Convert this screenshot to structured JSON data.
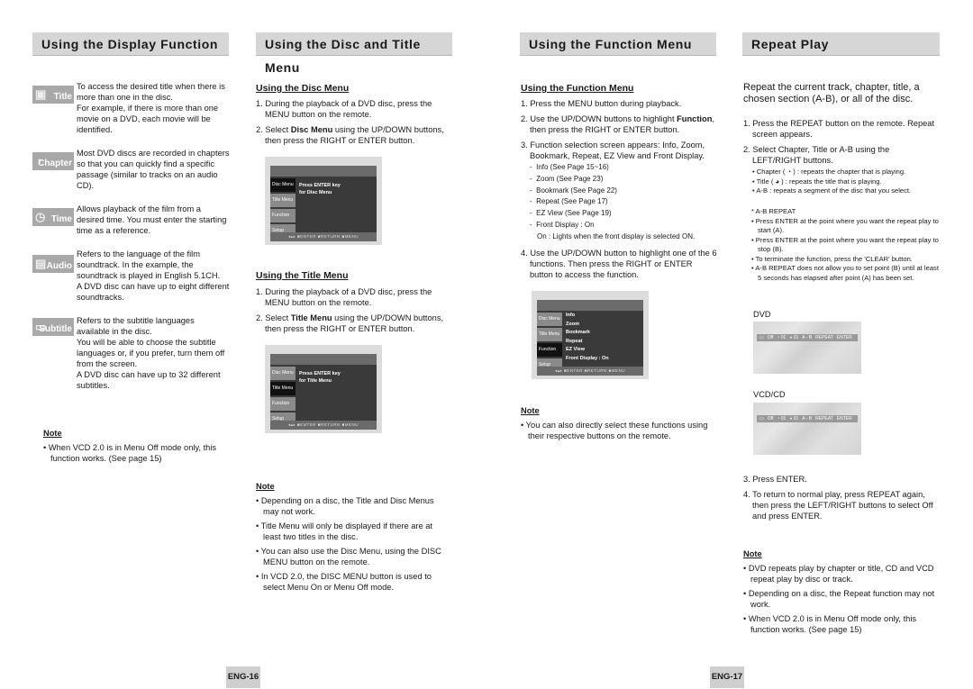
{
  "left_page": {
    "display_section": {
      "header": "Using the Display Function",
      "items": [
        {
          "icon": "title-icon",
          "label": "Title",
          "text": [
            "To access the desired title when there is more than one in the disc.",
            "For example, if there is more than one movie on a DVD, each movie will be identified."
          ]
        },
        {
          "icon": "chapter-icon",
          "label": "Chapter",
          "text": [
            "Most DVD discs are recorded in chapters so that you can quickly find a specific passage (similar to tracks on an audio CD)."
          ]
        },
        {
          "icon": "time-icon",
          "label": "Time",
          "text": [
            "Allows playback of the film from a desired time. You must enter the starting time as a reference."
          ]
        },
        {
          "icon": "audio-icon",
          "label": "Audio",
          "text": [
            "Refers to the language of the film soundtrack. In the example, the soundtrack is played in English 5.1CH.",
            "A DVD disc can have up to eight different soundtracks."
          ]
        },
        {
          "icon": "subtitle-icon",
          "label": "Subtitle",
          "text": [
            "Refers to the subtitle languages available in the disc.",
            "You will be able to choose the subtitle languages or, if you prefer, turn them off from the screen.",
            "A DVD disc can have up to 32 different subtitles."
          ]
        }
      ],
      "note_heading": "Note",
      "notes": [
        "When VCD 2.0 is in Menu Off mode only, this function works. (See page 15)"
      ]
    },
    "disc_title_section": {
      "header": "Using the Disc and Title Menu",
      "disc_menu": {
        "heading": "Using the Disc Menu",
        "steps": [
          {
            "num": "1.",
            "text": "During the playback of a DVD disc, press the MENU button on the remote."
          },
          {
            "num": "2.",
            "pre": "Select ",
            "bold": "Disc Menu",
            "post": " using the UP/DOWN buttons, then press the RIGHT or ENTER button."
          }
        ],
        "screen": {
          "side": [
            "Disc Menu",
            "Title Menu",
            "Function",
            "Setup"
          ],
          "selected": 0,
          "message": [
            "Press ENTER key",
            "for Disc Menu"
          ],
          "bottom": "◂▴▸  ■ENTER  ■RETURN  ■MENU"
        }
      },
      "title_menu": {
        "heading": "Using the Title Menu",
        "steps": [
          {
            "num": "1.",
            "text": "During the playback of a DVD disc, press the MENU button on the remote."
          },
          {
            "num": "2.",
            "pre": "Select ",
            "bold": "Title Menu",
            "post": " using the UP/DOWN buttons, then press the RIGHT or ENTER button."
          }
        ],
        "screen": {
          "side": [
            "Disc Menu",
            "Title Menu",
            "Function",
            "Setup"
          ],
          "selected": 1,
          "message": [
            "Press ENTER key",
            "for Title Menu"
          ],
          "bottom": "◂▴▸  ■ENTER  ■RETURN  ■MENU"
        }
      },
      "note_heading": "Note",
      "notes": [
        "Depending on a disc, the Title and Disc Menus may not work.",
        "Title Menu will only be displayed if there are at least two titles in the disc.",
        "You can also use the Disc Menu, using the DISC MENU button on the remote.",
        "In VCD 2.0, the DISC MENU button is used to select Menu On or Menu Off mode."
      ]
    },
    "page_number": "ENG-16"
  },
  "right_page": {
    "function_section": {
      "header": "Using the Function Menu",
      "heading": "Using the Function Menu",
      "step1": "Press the MENU button during playback.",
      "step2_pre": "Use the UP/DOWN buttons to highlight ",
      "step2_bold": "Function",
      "step2_post": ", then press the RIGHT or ENTER button.",
      "step3": "Function selection screen appears: Info, Zoom, Bookmark, Repeat, EZ View and Front Display.",
      "sub_items": [
        "Info (See Page 15~16)",
        "Zoom (See Page 23)",
        "Bookmark (See Page 22)",
        "Repeat (See Page 17)",
        "EZ View (See Page 19)",
        "Front Display : On"
      ],
      "sub_note": "On : Lights when the front display is selected ON.",
      "step4": "Use the UP/DOWN button to highlight one of the 6 functions. Then press the RIGHT or ENTER button to access the function.",
      "screen": {
        "side": [
          "Disc Menu",
          "Title Menu",
          "Function",
          "Setup"
        ],
        "selected": 2,
        "items": [
          "Info",
          "Zoom",
          "Bookmark",
          "Repeat",
          "EZ View",
          "Front Display : On"
        ],
        "bottom": "◂▴▸  ■ENTER  ■RETURN  ■MENU"
      },
      "note_heading": "Note",
      "notes": [
        "You can also directly select these functions using their respective buttons on the remote."
      ]
    },
    "repeat_section": {
      "header": "Repeat Play",
      "intro": "Repeat the current track, chapter, title, a chosen section (A-B), or all of the disc.",
      "step1": "Press the REPEAT button on the remote. Repeat screen appears.",
      "step2": "Select Chapter, Title or A-B using the LEFT/RIGHT buttons.",
      "step2_bullets": [
        "Chapter ( ◔ ) : repeats the chapter that is playing.",
        "Title ( ◕ ) : repeats the title that is playing.",
        "A-B : repeats a segment of the disc that you select."
      ],
      "ab_heading": "* A-B REPEAT",
      "ab_bullets": [
        "Press ENTER at the point where you want the repeat play to start (A).",
        "Press ENTER at the point where you want the repeat play to stop (B).",
        "To terminate the function, press the 'CLEAR' button.",
        "A-B REPEAT does not allow you to set point (B) until at least 5 seconds has elapsed after point (A) has been set."
      ],
      "dvd_label": "DVD",
      "dvd_bar": [
        "▭",
        "Off",
        "◔ 01",
        "◕ 01",
        "A - B",
        "REPEAT",
        "ENTER"
      ],
      "vcd_label": "VCD/CD",
      "vcd_bar": [
        "▭",
        "Off",
        "◔ 01",
        "◕ 01",
        "A - B",
        "REPEAT",
        "ENTER"
      ],
      "step3": "Press ENTER.",
      "step4": "To return to normal play, press REPEAT again, then press the LEFT/RIGHT buttons to select Off and press ENTER.",
      "note_heading": "Note",
      "notes": [
        "DVD repeats play by chapter or title, CD and VCD repeat play by disc or track.",
        "Depending on a disc, the Repeat function may not work.",
        "When VCD 2.0 is in Menu Off mode only, this function works. (See page 15)"
      ]
    },
    "page_number": "ENG-17"
  }
}
